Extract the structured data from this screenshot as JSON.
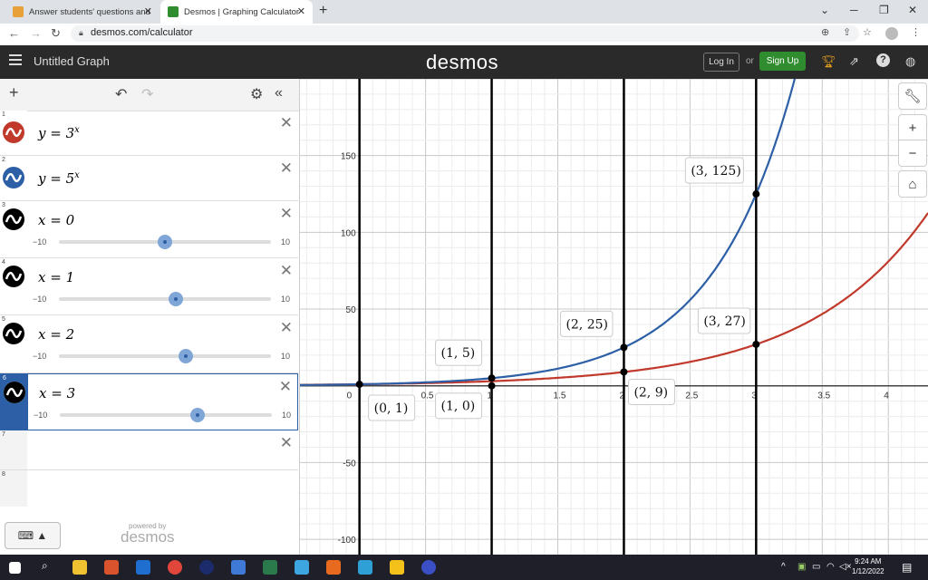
{
  "browser": {
    "tabs": [
      {
        "title": "Answer students' questions and"
      },
      {
        "title": "Desmos | Graphing Calculator"
      }
    ],
    "url": "desmos.com/calculator"
  },
  "header": {
    "graph_title": "Untitled Graph",
    "logo": "desmos",
    "login": "Log In",
    "or": "or",
    "signup": "Sign Up"
  },
  "panel": {
    "expressions": [
      {
        "num": "1",
        "base": "y = 3",
        "exp": "x",
        "color": "#c0392b"
      },
      {
        "num": "2",
        "base": "y = 5",
        "exp": "x",
        "color": "#2d5fa6"
      },
      {
        "num": "3",
        "text": "x = 0",
        "min": "−10",
        "max": "10",
        "value": 0
      },
      {
        "num": "4",
        "text": "x = 1",
        "min": "−10",
        "max": "10",
        "value": 1
      },
      {
        "num": "5",
        "text": "x = 2",
        "min": "−10",
        "max": "10",
        "value": 2
      },
      {
        "num": "6",
        "text": "x = 3",
        "min": "−10",
        "max": "10",
        "value": 3
      },
      {
        "num": "7"
      },
      {
        "num": "8"
      }
    ],
    "powered_by": "powered by",
    "footer_logo": "desmos"
  },
  "chart_data": {
    "type": "line",
    "xlim": [
      -0.45,
      4.3
    ],
    "ylim": [
      -110,
      200
    ],
    "x_ticks": [
      "0.5",
      "1",
      "1.5",
      "2",
      "2.5",
      "3",
      "3.5",
      "4"
    ],
    "x_origin_label": "0",
    "y_ticks": [
      "150",
      "100",
      "50",
      "-50",
      "-100"
    ],
    "grid": true,
    "series": [
      {
        "name": "y = 3^x",
        "color": "#c0392b",
        "base": 3
      },
      {
        "name": "y = 5^x",
        "color": "#2d5fa6",
        "base": 5
      }
    ],
    "vertical_lines": [
      0,
      1,
      2,
      3
    ],
    "points": [
      {
        "x": 0,
        "y": 1,
        "label": "(0, 1)"
      },
      {
        "x": 1,
        "y": 5,
        "label": "(1, 5)"
      },
      {
        "x": 1,
        "y": 0,
        "label": "(1, 0)"
      },
      {
        "x": 2,
        "y": 25,
        "label": "(2, 25)"
      },
      {
        "x": 2,
        "y": 9,
        "label": "(2, 9)"
      },
      {
        "x": 3,
        "y": 125,
        "label": "(3, 125)"
      },
      {
        "x": 3,
        "y": 27,
        "label": "(3, 27)"
      }
    ]
  },
  "taskbar": {
    "time": "9:24 AM",
    "date": "1/12/2022"
  }
}
